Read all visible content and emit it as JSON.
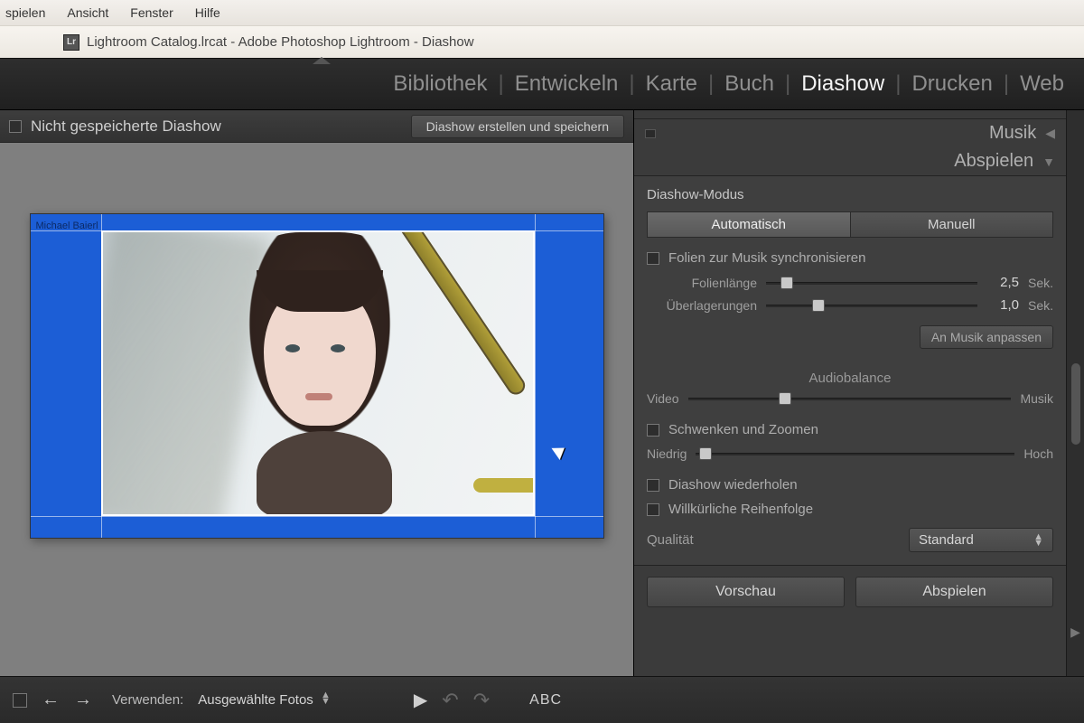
{
  "os_menu": {
    "items": [
      "spielen",
      "Ansicht",
      "Fenster",
      "Hilfe"
    ]
  },
  "window": {
    "title": "Lightroom Catalog.lrcat - Adobe Photoshop Lightroom - Diashow",
    "app_abbrev": "Lr"
  },
  "modules": {
    "items": [
      "Bibliothek",
      "Entwickeln",
      "Karte",
      "Buch",
      "Diashow",
      "Drucken",
      "Web"
    ],
    "active": "Diashow"
  },
  "center": {
    "title": "Nicht gespeicherte Diashow",
    "save_button": "Diashow erstellen und speichern",
    "slide_author": "Michael Baierl"
  },
  "right": {
    "collapsed_panel": "Musik",
    "expanded_panel": "Abspielen",
    "section_title": "Diashow-Modus",
    "mode": {
      "auto": "Automatisch",
      "manual": "Manuell",
      "active": "auto"
    },
    "sync_music": "Folien zur Musik synchronisieren",
    "slide_length": {
      "label": "Folienlänge",
      "value": "2,5",
      "unit": "Sek.",
      "pos": 0.1
    },
    "crossfade": {
      "label": "Überlagerungen",
      "value": "1,0",
      "unit": "Sek.",
      "pos": 0.25
    },
    "fit_button": "An Musik anpassen",
    "balance": {
      "title": "Audiobalance",
      "left": "Video",
      "right": "Musik",
      "pos": 0.3
    },
    "pan_zoom": "Schwenken und Zoomen",
    "panzoom_scale": {
      "left": "Niedrig",
      "right": "Hoch",
      "pos": 0.03
    },
    "repeat": "Diashow wiederholen",
    "random": "Willkürliche Reihenfolge",
    "quality": {
      "label": "Qualität",
      "value": "Standard"
    },
    "preview_btn": "Vorschau",
    "play_btn": "Abspielen"
  },
  "toolbar": {
    "use_label": "Verwenden:",
    "use_value": "Ausgewählte Fotos",
    "abc": "ABC"
  }
}
